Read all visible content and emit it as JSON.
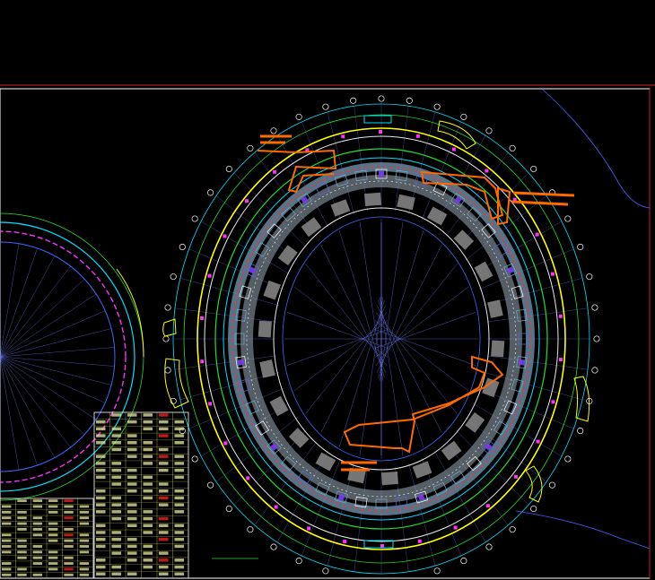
{
  "drawing": {
    "caption": "",
    "sheet_notes": []
  },
  "colors": {
    "background": "#000000",
    "frame": "#ffffff",
    "frame_top": "#cc2222",
    "ring_white": "#e8e8e8",
    "ring_cyan": "#00e0ff",
    "ring_green": "#22dd33",
    "ring_yellow": "#ffff00",
    "ring_red": "#ff3030",
    "ring_magenta": "#ff33ff",
    "ring_blue": "#4466ff",
    "seat_hatch": "#8a8a8a",
    "radial": "#7080ff",
    "markup_orange": "#ff6a00",
    "site_line": "#4a5dff"
  },
  "legend_table": {
    "rows": 24,
    "cols": 6
  },
  "icons": [
    "grid-bubble-icon",
    "revision-cloud-icon"
  ]
}
